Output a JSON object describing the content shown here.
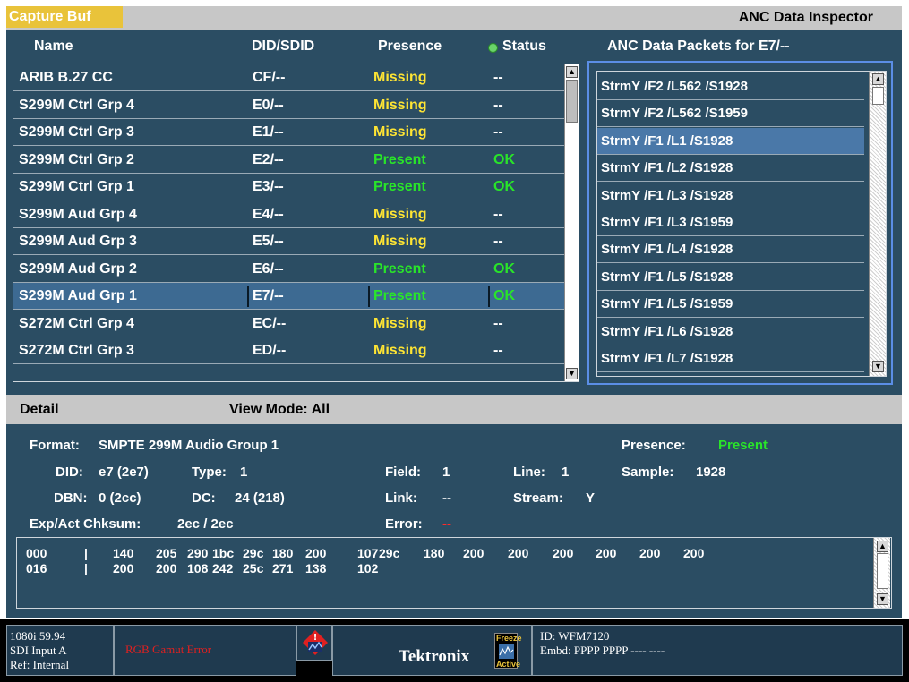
{
  "header": {
    "capture_label": "Capture Buf",
    "title": "ANC Data Inspector"
  },
  "columns": {
    "name": "Name",
    "did": "DID/SDID",
    "presence": "Presence",
    "status": "Status",
    "packets_title": "ANC Data Packets for E7/--"
  },
  "rows": [
    {
      "name": "ARIB B.27 CC",
      "did": "CF/--",
      "presence": "Missing",
      "status": "--"
    },
    {
      "name": "S299M Ctrl Grp 4",
      "did": "E0/--",
      "presence": "Missing",
      "status": "--"
    },
    {
      "name": "S299M Ctrl Grp 3",
      "did": "E1/--",
      "presence": "Missing",
      "status": "--"
    },
    {
      "name": "S299M Ctrl Grp 2",
      "did": "E2/--",
      "presence": "Present",
      "status": "OK"
    },
    {
      "name": "S299M Ctrl Grp 1",
      "did": "E3/--",
      "presence": "Present",
      "status": "OK"
    },
    {
      "name": "S299M Aud Grp 4",
      "did": "E4/--",
      "presence": "Missing",
      "status": "--"
    },
    {
      "name": "S299M Aud Grp 3",
      "did": "E5/--",
      "presence": "Missing",
      "status": "--"
    },
    {
      "name": "S299M Aud Grp 2",
      "did": "E6/--",
      "presence": "Present",
      "status": "OK"
    },
    {
      "name": "S299M Aud Grp 1",
      "did": "E7/--",
      "presence": "Present",
      "status": "OK"
    },
    {
      "name": "S272M Ctrl Grp 4",
      "did": "EC/--",
      "presence": "Missing",
      "status": "--"
    },
    {
      "name": "S272M Ctrl Grp 3",
      "did": "ED/--",
      "presence": "Missing",
      "status": "--"
    }
  ],
  "selected_row": 8,
  "packets": [
    "StrmY /F2 /L562 /S1928",
    "StrmY /F2 /L562 /S1959",
    "StrmY /F1 /L1 /S1928",
    "StrmY /F1 /L2 /S1928",
    "StrmY /F1 /L3 /S1928",
    "StrmY /F1 /L3 /S1959",
    "StrmY /F1 /L4 /S1928",
    "StrmY /F1 /L5 /S1928",
    "StrmY /F1 /L5 /S1959",
    "StrmY /F1 /L6 /S1928",
    "StrmY /F1 /L7 /S1928"
  ],
  "selected_packet": 2,
  "detail": {
    "label": "Detail",
    "view_mode": "View Mode: All",
    "format_label": "Format:",
    "format_value": "SMPTE 299M Audio Group 1",
    "presence_label": "Presence:",
    "presence_value": "Present",
    "did_label": "DID:",
    "did_value": "e7 (2e7)",
    "type_label": "Type:",
    "type_value": "1",
    "field_label": "Field:",
    "field_value": "1",
    "line_label": "Line:",
    "line_value": "1",
    "sample_label": "Sample:",
    "sample_value": "1928",
    "dbn_label": "DBN:",
    "dbn_value": "0 (2cc)",
    "dc_label": "DC:",
    "dc_value": "24 (218)",
    "link_label": "Link:",
    "link_value": "--",
    "stream_label": "Stream:",
    "stream_value": "Y",
    "chksum_label": "Exp/Act Chksum:",
    "chksum_value": "2ec / 2ec",
    "error_label": "Error:",
    "error_value": "--"
  },
  "hex": {
    "rows": [
      {
        "offset": "000",
        "values": [
          "140",
          "205",
          "290",
          "1bc",
          "29c",
          "180",
          "200",
          "107",
          "29c",
          "180",
          "200",
          "200",
          "200",
          "200",
          "200",
          "200"
        ]
      },
      {
        "offset": "016",
        "values": [
          "200",
          "200",
          "108",
          "242",
          "25c",
          "271",
          "138",
          "102"
        ]
      }
    ]
  },
  "statusbar": {
    "format": "1080i 59.94",
    "input": "SDI Input A",
    "ref": "Ref: Internal",
    "alarm": "RGB Gamut Error",
    "brand": "Tektronix",
    "freeze": "Freeze",
    "active": "Active",
    "id": "ID: WFM7120",
    "embd": "Embd: PPPP PPPP ---- ----"
  },
  "colors": {
    "present": "#29e529",
    "missing": "#ffe533",
    "error": "#ff2a2a",
    "selection": "#3d6a92",
    "background": "#2b4d63"
  }
}
